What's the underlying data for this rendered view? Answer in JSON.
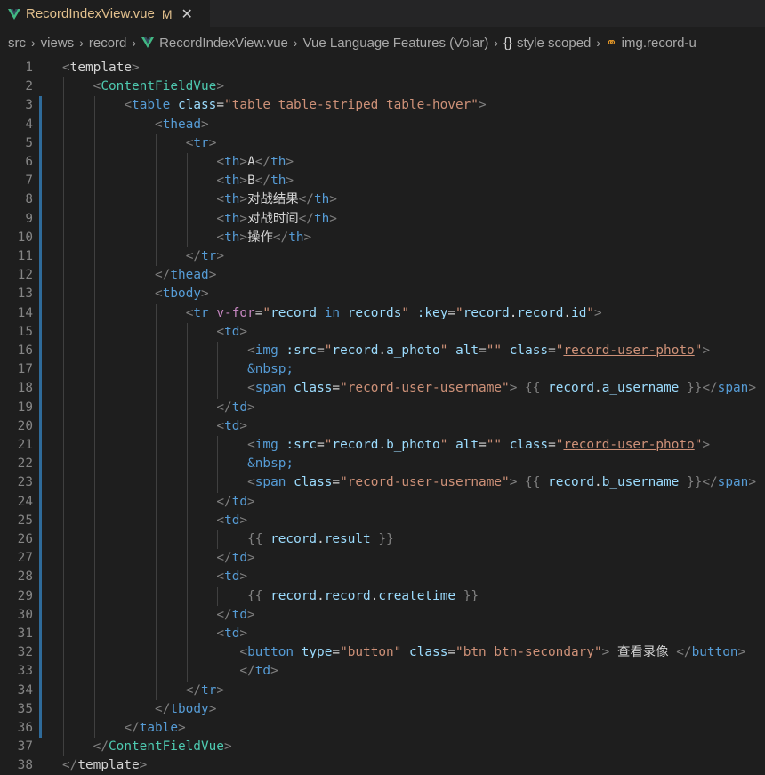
{
  "tab": {
    "title": "RecordIndexView.vue",
    "badge": "M",
    "close": "✕"
  },
  "breadcrumb": {
    "items": [
      "src",
      "views",
      "record",
      "RecordIndexView.vue",
      "Vue Language Features (Volar)",
      "style scoped",
      "img.record-u"
    ],
    "icons": [
      "",
      "",
      "",
      "vue-icon",
      "",
      "braces-icon",
      "selector-icon"
    ]
  },
  "colors": {
    "background": "#1e1e1e",
    "tag": "#569cd6",
    "component": "#4ec9b0",
    "attr": "#9cdcfe",
    "string": "#ce9178",
    "directive": "#c586c0"
  },
  "lines": [
    {
      "n": "1",
      "indent": 0,
      "tokens": [
        [
          "punc",
          "<"
        ],
        [
          "tmpl",
          "template"
        ],
        [
          "punc",
          ">"
        ]
      ]
    },
    {
      "n": "2",
      "indent": 1,
      "tokens": [
        [
          "punc",
          "<"
        ],
        [
          "comp",
          "ContentFieldVue"
        ],
        [
          "punc",
          ">"
        ]
      ]
    },
    {
      "n": "3",
      "indent": 2,
      "tokens": [
        [
          "punc",
          "<"
        ],
        [
          "tag",
          "table"
        ],
        [
          "txt",
          " "
        ],
        [
          "attr",
          "class"
        ],
        [
          "txt",
          "="
        ],
        [
          "str",
          "\"table table-striped table-hover\""
        ],
        [
          "punc",
          ">"
        ]
      ]
    },
    {
      "n": "4",
      "indent": 3,
      "tokens": [
        [
          "punc",
          "<"
        ],
        [
          "tag",
          "thead"
        ],
        [
          "punc",
          ">"
        ]
      ]
    },
    {
      "n": "5",
      "indent": 4,
      "tokens": [
        [
          "punc",
          "<"
        ],
        [
          "tag",
          "tr"
        ],
        [
          "punc",
          ">"
        ]
      ]
    },
    {
      "n": "6",
      "indent": 5,
      "tokens": [
        [
          "punc",
          "<"
        ],
        [
          "tag",
          "th"
        ],
        [
          "punc",
          ">"
        ],
        [
          "txt",
          "A"
        ],
        [
          "punc",
          "</"
        ],
        [
          "tag",
          "th"
        ],
        [
          "punc",
          ">"
        ]
      ]
    },
    {
      "n": "7",
      "indent": 5,
      "tokens": [
        [
          "punc",
          "<"
        ],
        [
          "tag",
          "th"
        ],
        [
          "punc",
          ">"
        ],
        [
          "txt",
          "B"
        ],
        [
          "punc",
          "</"
        ],
        [
          "tag",
          "th"
        ],
        [
          "punc",
          ">"
        ]
      ]
    },
    {
      "n": "8",
      "indent": 5,
      "tokens": [
        [
          "punc",
          "<"
        ],
        [
          "tag",
          "th"
        ],
        [
          "punc",
          ">"
        ],
        [
          "txtw",
          "对战结果"
        ],
        [
          "punc",
          "</"
        ],
        [
          "tag",
          "th"
        ],
        [
          "punc",
          ">"
        ]
      ]
    },
    {
      "n": "9",
      "indent": 5,
      "tokens": [
        [
          "punc",
          "<"
        ],
        [
          "tag",
          "th"
        ],
        [
          "punc",
          ">"
        ],
        [
          "txtw",
          "对战时间"
        ],
        [
          "punc",
          "</"
        ],
        [
          "tag",
          "th"
        ],
        [
          "punc",
          ">"
        ]
      ]
    },
    {
      "n": "10",
      "indent": 5,
      "tokens": [
        [
          "punc",
          "<"
        ],
        [
          "tag",
          "th"
        ],
        [
          "punc",
          ">"
        ],
        [
          "txtw",
          "操作"
        ],
        [
          "punc",
          "</"
        ],
        [
          "tag",
          "th"
        ],
        [
          "punc",
          ">"
        ]
      ]
    },
    {
      "n": "11",
      "indent": 4,
      "tokens": [
        [
          "punc",
          "</"
        ],
        [
          "tag",
          "tr"
        ],
        [
          "punc",
          ">"
        ]
      ]
    },
    {
      "n": "12",
      "indent": 3,
      "tokens": [
        [
          "punc",
          "</"
        ],
        [
          "tag",
          "thead"
        ],
        [
          "punc",
          ">"
        ]
      ]
    },
    {
      "n": "13",
      "indent": 3,
      "tokens": [
        [
          "punc",
          "<"
        ],
        [
          "tag",
          "tbody"
        ],
        [
          "punc",
          ">"
        ]
      ]
    },
    {
      "n": "14",
      "indent": 4,
      "tokens": [
        [
          "punc",
          "<"
        ],
        [
          "tag",
          "tr"
        ],
        [
          "txt",
          " "
        ],
        [
          "dir",
          "v-for"
        ],
        [
          "txt",
          "="
        ],
        [
          "str",
          "\""
        ],
        [
          "var",
          "record"
        ],
        [
          "txt",
          " "
        ],
        [
          "kw",
          "in"
        ],
        [
          "txt",
          " "
        ],
        [
          "var",
          "records"
        ],
        [
          "str",
          "\""
        ],
        [
          "txt",
          " "
        ],
        [
          "attr",
          ":key"
        ],
        [
          "txt",
          "="
        ],
        [
          "str",
          "\""
        ],
        [
          "var",
          "record"
        ],
        [
          "txt",
          "."
        ],
        [
          "var",
          "record"
        ],
        [
          "txt",
          "."
        ],
        [
          "var",
          "id"
        ],
        [
          "str",
          "\""
        ],
        [
          "punc",
          ">"
        ]
      ]
    },
    {
      "n": "15",
      "indent": 5,
      "tokens": [
        [
          "punc",
          "<"
        ],
        [
          "tag",
          "td"
        ],
        [
          "punc",
          ">"
        ]
      ]
    },
    {
      "n": "16",
      "indent": 6,
      "tokens": [
        [
          "punc",
          "<"
        ],
        [
          "tag",
          "img"
        ],
        [
          "txt",
          " "
        ],
        [
          "attr",
          ":src"
        ],
        [
          "txt",
          "="
        ],
        [
          "str",
          "\""
        ],
        [
          "var",
          "record"
        ],
        [
          "txt",
          "."
        ],
        [
          "var",
          "a_photo"
        ],
        [
          "str",
          "\""
        ],
        [
          "txt",
          " "
        ],
        [
          "attr",
          "alt"
        ],
        [
          "txt",
          "="
        ],
        [
          "str",
          "\"\""
        ],
        [
          "txt",
          " "
        ],
        [
          "attr",
          "class"
        ],
        [
          "txt",
          "="
        ],
        [
          "str",
          "\""
        ],
        [
          "strs",
          "record-user-photo"
        ],
        [
          "str",
          "\""
        ],
        [
          "punc",
          ">"
        ]
      ]
    },
    {
      "n": "17",
      "indent": 6,
      "tokens": [
        [
          "ent",
          "&nbsp;"
        ]
      ]
    },
    {
      "n": "18",
      "indent": 6,
      "tokens": [
        [
          "punc",
          "<"
        ],
        [
          "tag",
          "span"
        ],
        [
          "txt",
          " "
        ],
        [
          "attr",
          "class"
        ],
        [
          "txt",
          "="
        ],
        [
          "str",
          "\"record-user-username\""
        ],
        [
          "punc",
          ">"
        ],
        [
          "txt",
          " "
        ],
        [
          "punc",
          "{{"
        ],
        [
          "txt",
          " "
        ],
        [
          "var",
          "record"
        ],
        [
          "txt",
          "."
        ],
        [
          "var",
          "a_username"
        ],
        [
          "txt",
          " "
        ],
        [
          "punc",
          "}}"
        ],
        [
          "punc",
          "</"
        ],
        [
          "tag",
          "span"
        ],
        [
          "punc",
          ">"
        ]
      ]
    },
    {
      "n": "19",
      "indent": 5,
      "tokens": [
        [
          "punc",
          "</"
        ],
        [
          "tag",
          "td"
        ],
        [
          "punc",
          ">"
        ]
      ]
    },
    {
      "n": "20",
      "indent": 5,
      "tokens": [
        [
          "punc",
          "<"
        ],
        [
          "tag",
          "td"
        ],
        [
          "punc",
          ">"
        ]
      ]
    },
    {
      "n": "21",
      "indent": 6,
      "tokens": [
        [
          "punc",
          "<"
        ],
        [
          "tag",
          "img"
        ],
        [
          "txt",
          " "
        ],
        [
          "attr",
          ":src"
        ],
        [
          "txt",
          "="
        ],
        [
          "str",
          "\""
        ],
        [
          "var",
          "record"
        ],
        [
          "txt",
          "."
        ],
        [
          "var",
          "b_photo"
        ],
        [
          "str",
          "\""
        ],
        [
          "txt",
          " "
        ],
        [
          "attr",
          "alt"
        ],
        [
          "txt",
          "="
        ],
        [
          "str",
          "\"\""
        ],
        [
          "txt",
          " "
        ],
        [
          "attr",
          "class"
        ],
        [
          "txt",
          "="
        ],
        [
          "str",
          "\""
        ],
        [
          "strs",
          "record-user-photo"
        ],
        [
          "str",
          "\""
        ],
        [
          "punc",
          ">"
        ]
      ]
    },
    {
      "n": "22",
      "indent": 6,
      "tokens": [
        [
          "ent",
          "&nbsp;"
        ]
      ]
    },
    {
      "n": "23",
      "indent": 6,
      "tokens": [
        [
          "punc",
          "<"
        ],
        [
          "tag",
          "span"
        ],
        [
          "txt",
          " "
        ],
        [
          "attr",
          "class"
        ],
        [
          "txt",
          "="
        ],
        [
          "str",
          "\"record-user-username\""
        ],
        [
          "punc",
          ">"
        ],
        [
          "txt",
          " "
        ],
        [
          "punc",
          "{{"
        ],
        [
          "txt",
          " "
        ],
        [
          "var",
          "record"
        ],
        [
          "txt",
          "."
        ],
        [
          "var",
          "b_username"
        ],
        [
          "txt",
          " "
        ],
        [
          "punc",
          "}}"
        ],
        [
          "punc",
          "</"
        ],
        [
          "tag",
          "span"
        ],
        [
          "punc",
          ">"
        ]
      ]
    },
    {
      "n": "24",
      "indent": 5,
      "tokens": [
        [
          "punc",
          "</"
        ],
        [
          "tag",
          "td"
        ],
        [
          "punc",
          ">"
        ]
      ]
    },
    {
      "n": "25",
      "indent": 5,
      "tokens": [
        [
          "punc",
          "<"
        ],
        [
          "tag",
          "td"
        ],
        [
          "punc",
          ">"
        ]
      ]
    },
    {
      "n": "26",
      "indent": 6,
      "tokens": [
        [
          "punc",
          "{{"
        ],
        [
          "txt",
          " "
        ],
        [
          "var",
          "record"
        ],
        [
          "txt",
          "."
        ],
        [
          "var",
          "result"
        ],
        [
          "txt",
          " "
        ],
        [
          "punc",
          "}}"
        ]
      ]
    },
    {
      "n": "27",
      "indent": 5,
      "tokens": [
        [
          "punc",
          "</"
        ],
        [
          "tag",
          "td"
        ],
        [
          "punc",
          ">"
        ]
      ]
    },
    {
      "n": "28",
      "indent": 5,
      "tokens": [
        [
          "punc",
          "<"
        ],
        [
          "tag",
          "td"
        ],
        [
          "punc",
          ">"
        ]
      ]
    },
    {
      "n": "29",
      "indent": 6,
      "tokens": [
        [
          "punc",
          "{{"
        ],
        [
          "txt",
          " "
        ],
        [
          "var",
          "record"
        ],
        [
          "txt",
          "."
        ],
        [
          "var",
          "record"
        ],
        [
          "txt",
          "."
        ],
        [
          "var",
          "createtime"
        ],
        [
          "txt",
          " "
        ],
        [
          "punc",
          "}}"
        ]
      ]
    },
    {
      "n": "30",
      "indent": 5,
      "tokens": [
        [
          "punc",
          "</"
        ],
        [
          "tag",
          "td"
        ],
        [
          "punc",
          ">"
        ]
      ]
    },
    {
      "n": "31",
      "indent": 5,
      "tokens": [
        [
          "punc",
          "<"
        ],
        [
          "tag",
          "td"
        ],
        [
          "punc",
          ">"
        ]
      ]
    },
    {
      "n": "32",
      "indent": 5.75,
      "tokens": [
        [
          "punc",
          "<"
        ],
        [
          "tag",
          "button"
        ],
        [
          "txt",
          " "
        ],
        [
          "attr",
          "type"
        ],
        [
          "txt",
          "="
        ],
        [
          "str",
          "\"button\""
        ],
        [
          "txt",
          " "
        ],
        [
          "attr",
          "class"
        ],
        [
          "txt",
          "="
        ],
        [
          "str",
          "\"btn btn-secondary\""
        ],
        [
          "punc",
          ">"
        ],
        [
          "txt",
          " "
        ],
        [
          "txtw",
          "查看录像"
        ],
        [
          "txt",
          " "
        ],
        [
          "punc",
          "</"
        ],
        [
          "tag",
          "button"
        ],
        [
          "punc",
          ">"
        ]
      ]
    },
    {
      "n": "33",
      "indent": 5.75,
      "tokens": [
        [
          "punc",
          "</"
        ],
        [
          "tag",
          "td"
        ],
        [
          "punc",
          ">"
        ]
      ]
    },
    {
      "n": "34",
      "indent": 4,
      "tokens": [
        [
          "punc",
          "</"
        ],
        [
          "tag",
          "tr"
        ],
        [
          "punc",
          ">"
        ]
      ]
    },
    {
      "n": "35",
      "indent": 3,
      "tokens": [
        [
          "punc",
          "</"
        ],
        [
          "tag",
          "tbody"
        ],
        [
          "punc",
          ">"
        ]
      ]
    },
    {
      "n": "36",
      "indent": 2,
      "tokens": [
        [
          "punc",
          "</"
        ],
        [
          "tag",
          "table"
        ],
        [
          "punc",
          ">"
        ]
      ]
    },
    {
      "n": "37",
      "indent": 1,
      "tokens": [
        [
          "punc",
          "</"
        ],
        [
          "comp",
          "ContentFieldVue"
        ],
        [
          "punc",
          ">"
        ]
      ]
    },
    {
      "n": "38",
      "indent": 0,
      "tokens": [
        [
          "punc",
          "</"
        ],
        [
          "tmpl",
          "template"
        ],
        [
          "punc",
          ">"
        ]
      ]
    }
  ]
}
